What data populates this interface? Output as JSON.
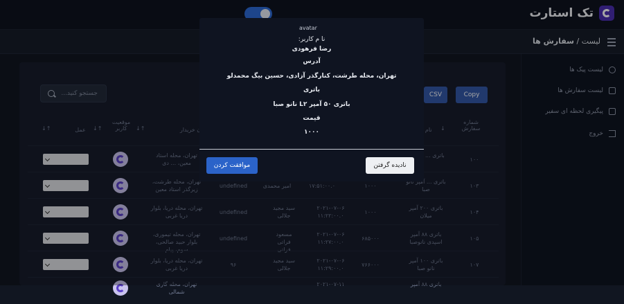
{
  "brand": {
    "name": "تک استارت"
  },
  "breadcrumb": {
    "parent": "لیست",
    "separator": "/",
    "current": "سفارش ها"
  },
  "sidebar": {
    "items": [
      {
        "label": "لیست پیک ها",
        "icon": "user-icon"
      },
      {
        "label": "لیست سفارش ها",
        "icon": "list-icon"
      },
      {
        "label": "پیگیری لحظه ای سفیر",
        "icon": "track-icon"
      },
      {
        "label": "خروج",
        "icon": "exit-icon"
      }
    ]
  },
  "toolbar": {
    "search_placeholder": "جستجو کنید...",
    "csv_label": "CSV",
    "copy_label": "Copy"
  },
  "table": {
    "headers": {
      "order_number": "شماره سفارش",
      "product": "نام م",
      "buyer": "ن خریدار",
      "courier_status": "موقعیت کاربر",
      "action": "عمل"
    },
    "rows": [
      {
        "id": "۱۰۰",
        "product": "باتری ... نانو ص",
        "price": "",
        "date": "",
        "buyer": "",
        "extra": "",
        "address": "تهران، محله استاد معین، ... دی"
      },
      {
        "id": "۱۰۳",
        "product": "باتری ... آمپر نانو صبا",
        "price": "۱۰۰۰",
        "date": "۱۷:۵۱:۰۰.۰",
        "buyer": "امیر محمدی",
        "extra": "undefined",
        "address": "تهران، محله طرشت، زیرگذر استاد معین"
      },
      {
        "id": "۱۰۴",
        "product": "باتری ۲۰۰ آمپر میلان",
        "price": "۱۰۰۰",
        "date": "۲۰۲۱-۰۷-۰۶ ۱۱:۲۲:۰۰.۰",
        "buyer": "سید مجید جلالی",
        "extra": "undefined",
        "address": "تهران، محله دریا، بلوار دریا غربی"
      },
      {
        "id": "۱۰۵",
        "product": "باتری ۸۸ آمپر اسپدی نانوصبا",
        "price": "۶۸۵۰۰۰",
        "date": "۲۰۲۱-۰۷-۰۶ ۱۱:۲۷:۰۰.۰",
        "buyer": "مسعود فراتی فراتی",
        "extra": "undefined",
        "address": "تهران، محله تیموری، بلوار حبید صالحی، سوم، پیام"
      },
      {
        "id": "۱۰۷",
        "product": "باتری ۱۰۰ آمپر نانو صبا",
        "price": "۷۶۶۰۰۰",
        "date": "۲۰۲۱-۰۷-۰۶ ۱۱:۲۹:۰۰.۰",
        "buyer": "سید مجید جلالی",
        "extra": "۹۶",
        "address": "تهران، محله دریا، بلوار دریا غربی"
      }
    ],
    "partial_row": {
      "date": "۲۰۲۱-۰۷-۱۱",
      "product": "باتری ۸۸ آمپر",
      "address": "تهران، محله گاری شمالی"
    }
  },
  "modal": {
    "avatar_alt": "avatar",
    "user_label": "نا م کاربر:",
    "user_name": "رضا فرهودی",
    "address_label": "آدرس",
    "address_value": "تهران، محله طرشت، کنارگذر آزادی، حسین بیگ محمدلو",
    "product_label": "باتری",
    "product_value": "باتری ۵۰ آمپر L۲ نانو صبا",
    "price_label": "قیمت",
    "price_value": "۱۰۰۰",
    "confirm_label": "موافقت کردن",
    "ignore_label": "نادیده گرفتن"
  }
}
